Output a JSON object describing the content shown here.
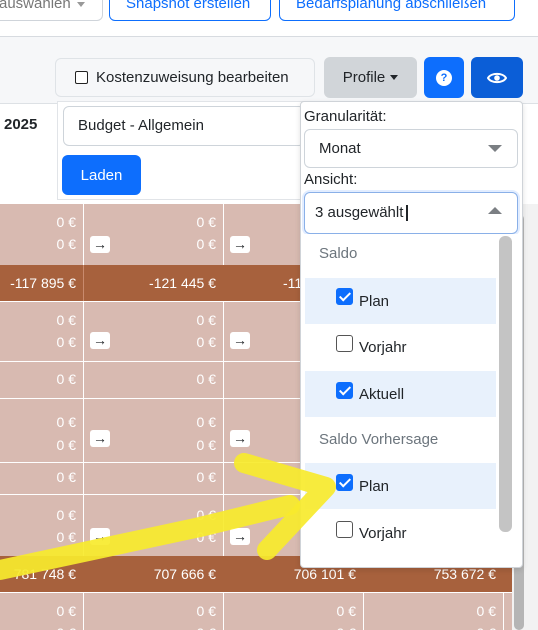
{
  "top_buttons": {
    "select_label": "auswählen",
    "snapshot_label": "Snapshot erstellen",
    "bedarfsplanung_label": "Bedarfsplanung abschließen"
  },
  "header": {
    "kosten_label": "Kostenzuweisung bearbeiten",
    "profile_label": "Profile",
    "help_icon": "question-circle-icon",
    "eye_icon": "eye-icon",
    "accent_color": "#0d6efd"
  },
  "left": {
    "year": "2025",
    "budget_value": "Budget - Allgemein",
    "laden_label": "Laden"
  },
  "dropdown": {
    "granularity_label": "Granularität:",
    "granularity_value": "Monat",
    "view_label": "Ansicht:",
    "view_value": "3 ausgewählt",
    "groups": [
      {
        "label": "Saldo",
        "options": [
          {
            "label": "Plan",
            "checked": true
          },
          {
            "label": "Vorjahr",
            "checked": false
          },
          {
            "label": "Aktuell",
            "checked": true
          }
        ]
      },
      {
        "label": "Saldo Vorhersage",
        "options": [
          {
            "label": "Plan",
            "checked": true
          },
          {
            "label": "Vorjahr",
            "checked": false
          }
        ]
      }
    ]
  },
  "table": {
    "cell_color": "#d8bab1",
    "total_color": "#a7613d",
    "zero": "0 €",
    "arrow_glyph": "→",
    "total_row_1": [
      "-117 895 €",
      "-121 445 €",
      "-11"
    ],
    "total_row_2": [
      "781 748 €",
      "707 666 €",
      "706 101 €",
      "753 672 €"
    ]
  }
}
